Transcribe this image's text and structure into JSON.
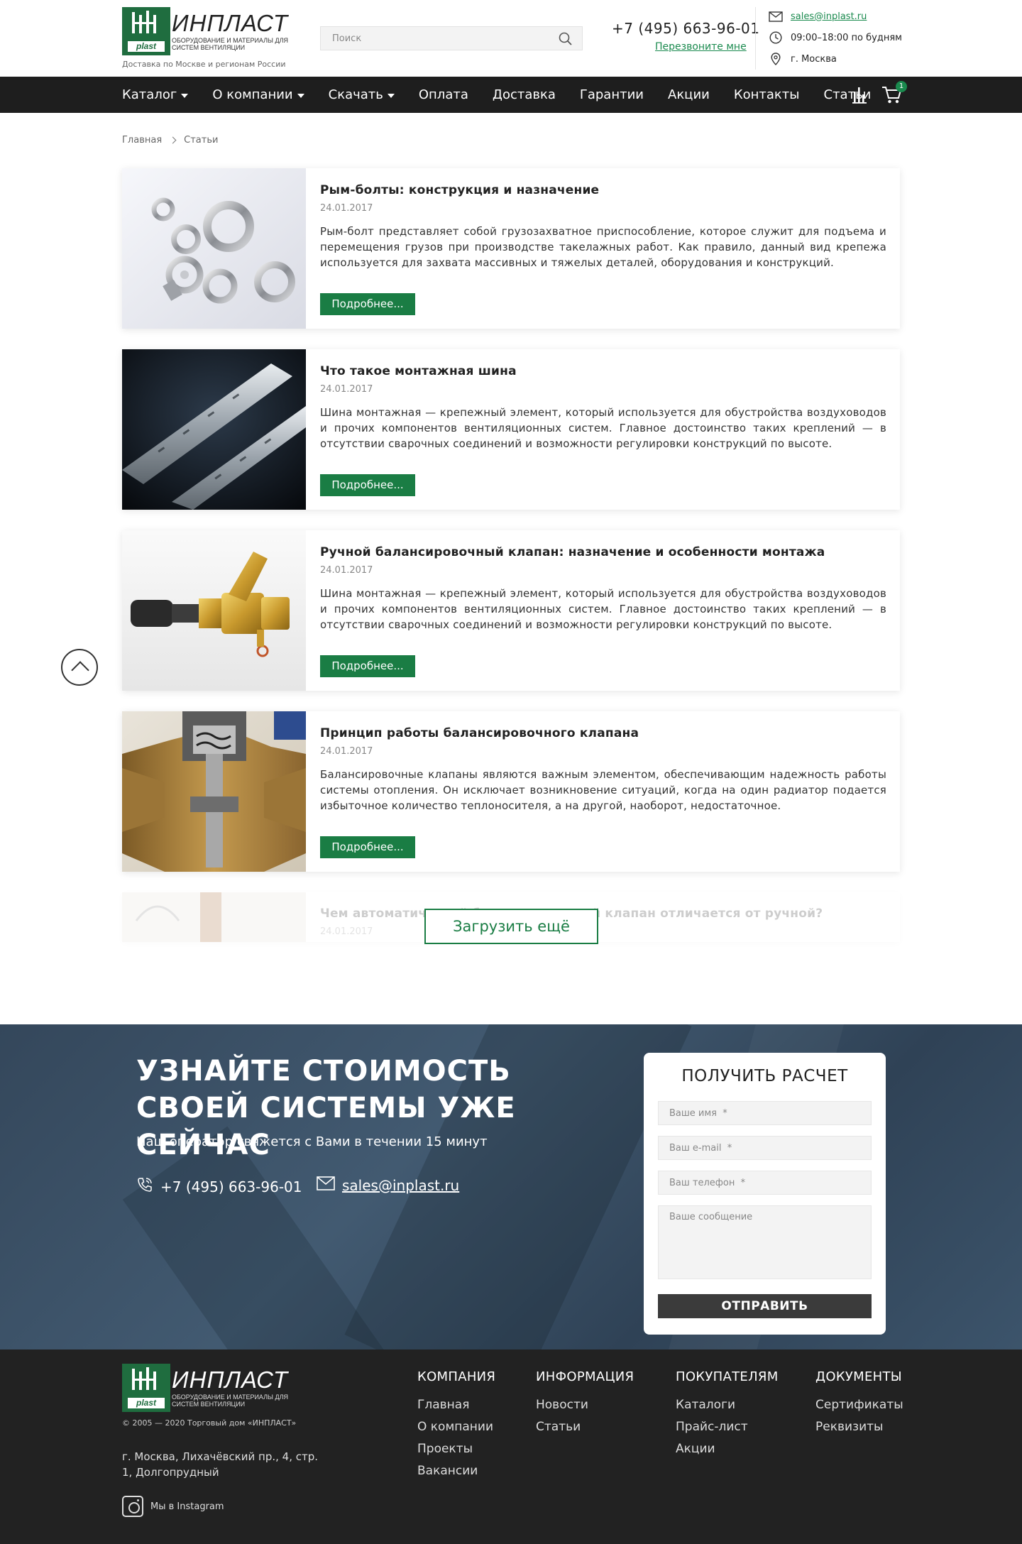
{
  "header": {
    "logo_name": "ИНПЛАСТ",
    "logo_subtitle": "Оборудование и материалы для систем вентиляции",
    "logo_plast": "plast",
    "delivery_note": "Доставка по Москве и регионам России",
    "search_placeholder": "Поиск",
    "phone": "+7 (495) 663-96-01",
    "callback": "Перезвоните мне",
    "email": "sales@inplast.ru",
    "hours": "09:00–18:00 по будням",
    "city": "г. Москва"
  },
  "nav": {
    "items": [
      {
        "label": "Каталог"
      },
      {
        "label": "О компании"
      },
      {
        "label": "Скачать"
      },
      {
        "label": "Оплата"
      },
      {
        "label": "Доставка"
      },
      {
        "label": "Гарантии"
      },
      {
        "label": "Акции"
      },
      {
        "label": "Контакты"
      },
      {
        "label": "Статьи"
      }
    ],
    "cart_count": "1"
  },
  "breadcrumb": {
    "home": "Главная",
    "current": "Статьи"
  },
  "articles": [
    {
      "title": "Рым-болты: конструкция и назначение",
      "date": "24.01.2017",
      "text": "Рым-болт представляет собой грузозахватное приспособление, которое служит для подъема и перемещения грузов при производстве такелажных работ. Как правило, данный вид крепежа используется для захвата массивных и тяжелых деталей, оборудования и конструкций.",
      "button": "Подробнее..."
    },
    {
      "title": "Что такое монтажная шина",
      "date": "24.01.2017",
      "text": "Шина монтажная — крепежный элемент, который используется для обустройства воздуховодов и прочих компонентов вентиляционных систем. Главное достоинство таких креплений — в отсутствии сварочных соединений и возможности регулировки конструкций по высоте.",
      "button": "Подробнее..."
    },
    {
      "title": "Ручной балансировочный клапан: назначение и особенности монтажа",
      "date": "24.01.2017",
      "text": "Шина монтажная — крепежный элемент, который используется для обустройства воздуховодов и прочих компонентов вентиляционных систем. Главное достоинство таких креплений — в отсутствии сварочных соединений и возможности регулировки конструкций по высоте.",
      "button": "Подробнее..."
    },
    {
      "title": "Принцип работы балансировочного клапана",
      "date": "24.01.2017",
      "text": "Балансировочные клапаны являются важным элементом, обеспечивающим надежность работы системы отопления. Он исключает возникновение ситуаций, когда на один радиатор подается избыточное количество теплоносителя, а на другой, наоборот, недостаточное.",
      "button": "Подробнее..."
    },
    {
      "title": "Чем автоматический балансировочный клапан отличается от ручной?",
      "date": "24.01.2017"
    }
  ],
  "load_more": "Загрузить ещё",
  "cta": {
    "title": "Узнайте стоимость своей системы уже сейчас",
    "subtitle": "Наш оператор свяжется с Вами в течении 15 минут",
    "phone": "+7 (495) 663-96-01",
    "email": "sales@inplast.ru"
  },
  "form": {
    "title": "ПОЛУЧИТЬ РАСЧЕТ",
    "name_placeholder": "Ваше имя  *",
    "email_placeholder": "Ваш e-mail  *",
    "phone_placeholder": "Ваш телефон  *",
    "message_placeholder": "Ваше сообщение",
    "submit": "ОТПРАВИТЬ"
  },
  "footer": {
    "copyright": "© 2005 — 2020 Торговый дом «ИНПЛАСТ»",
    "address": "г. Москва, Лихачёвский пр., 4, стр. 1, Долгопрудный",
    "instagram": "Мы в Instagram",
    "columns": [
      {
        "title": "Компания",
        "links": [
          "Главная",
          "О компании",
          "Проекты",
          "Вакансии"
        ]
      },
      {
        "title": "Информация",
        "links": [
          "Новости",
          "Статьи"
        ]
      },
      {
        "title": "Покупателям",
        "links": [
          "Каталоги",
          "Прайс-лист",
          "Акции"
        ]
      },
      {
        "title": "Документы",
        "links": [
          "Сертификаты",
          "Реквизиты"
        ]
      }
    ]
  },
  "colors": {
    "brand_green": "#1a7d44",
    "nav_bg": "#1e1e1e",
    "footer_bg": "#222222",
    "cta_bg": "#3c546b"
  }
}
